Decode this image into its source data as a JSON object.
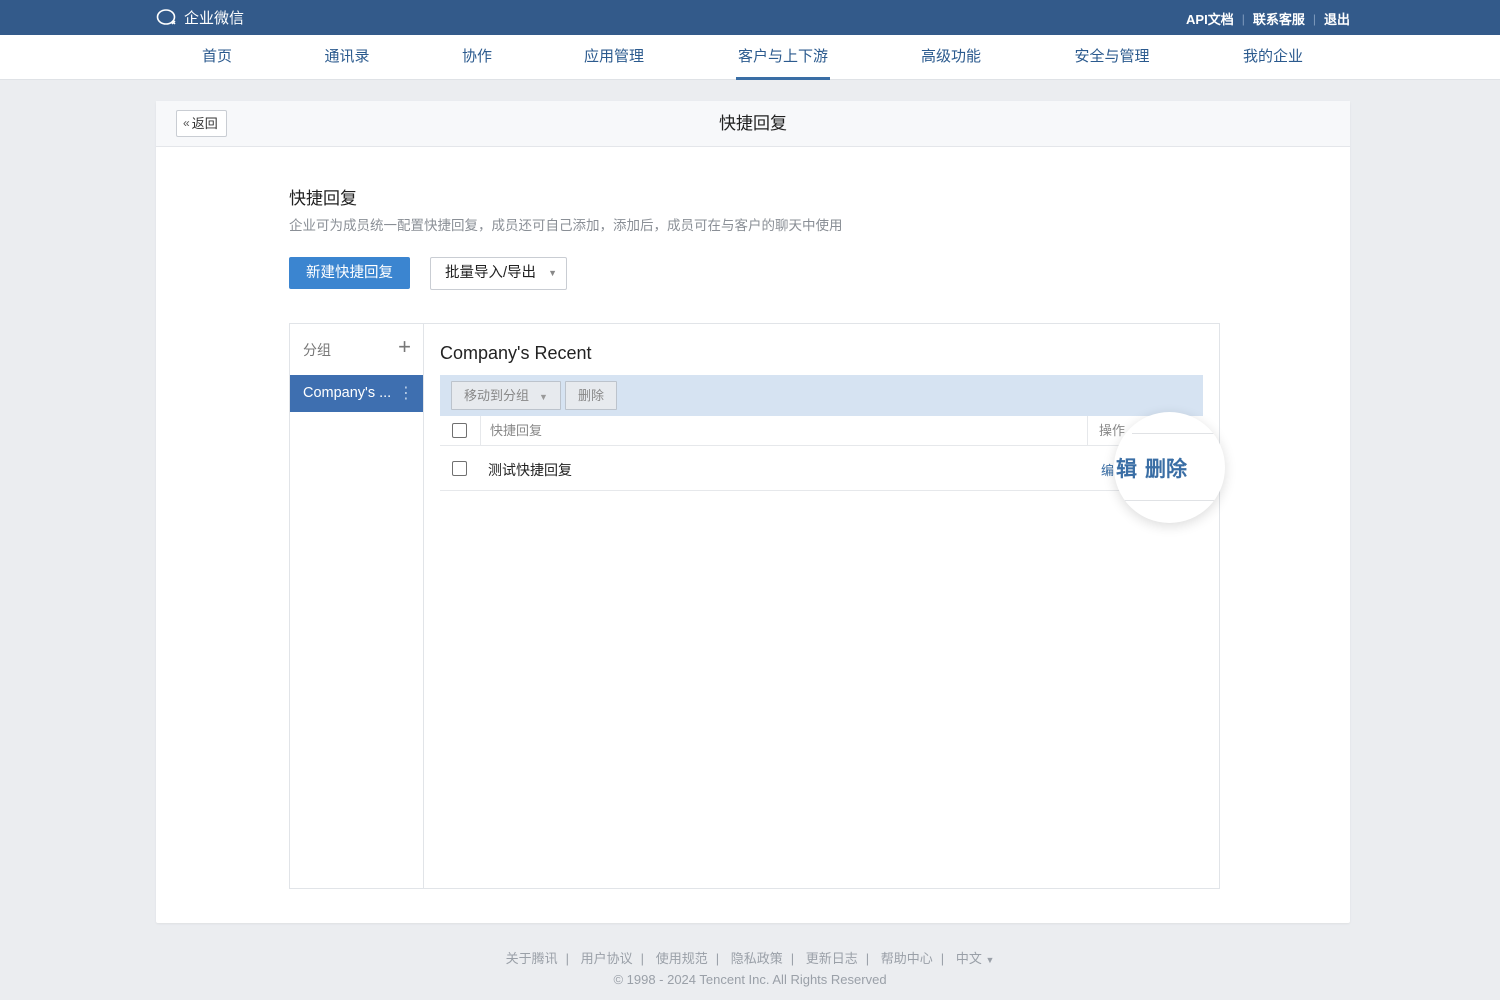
{
  "topbar": {
    "brand": "企业微信",
    "links": [
      "API文档",
      "联系客服",
      "退出"
    ]
  },
  "nav": {
    "items": [
      "首页",
      "通讯录",
      "协作",
      "应用管理",
      "客户与上下游",
      "高级功能",
      "安全与管理",
      "我的企业"
    ],
    "active_index": 4
  },
  "header": {
    "back_label": "返回",
    "title": "快捷回复"
  },
  "section": {
    "title": "快捷回复",
    "description": "企业可为成员统一配置快捷回复，成员还可自己添加，添加后，成员可在与客户的聊天中使用"
  },
  "buttons": {
    "create": "新建快捷回复",
    "batch": "批量导入/导出"
  },
  "groups": {
    "header_label": "分组",
    "items": [
      {
        "label": "Company's ..."
      }
    ]
  },
  "list": {
    "title": "Company's Recent",
    "toolbar": {
      "move": "移动到分组",
      "delete": "删除"
    },
    "columns": {
      "reply": "快捷回复",
      "actions": "操作"
    },
    "rows": [
      {
        "name": "测试快捷回复",
        "edit_partial": "编"
      }
    ]
  },
  "magnifier": {
    "edit_partial": "辑",
    "delete": "删除"
  },
  "footer": {
    "links": [
      "关于腾讯",
      "用户协议",
      "使用规范",
      "隐私政策",
      "更新日志",
      "帮助中心",
      "中文"
    ],
    "copyright": "© 1998 - 2024 Tencent Inc. All Rights Reserved"
  },
  "colors": {
    "topbar": "#335a8a",
    "accent": "#3b85d0",
    "group_active": "#3e6fb0",
    "toolbar": "#d6e3f2"
  }
}
